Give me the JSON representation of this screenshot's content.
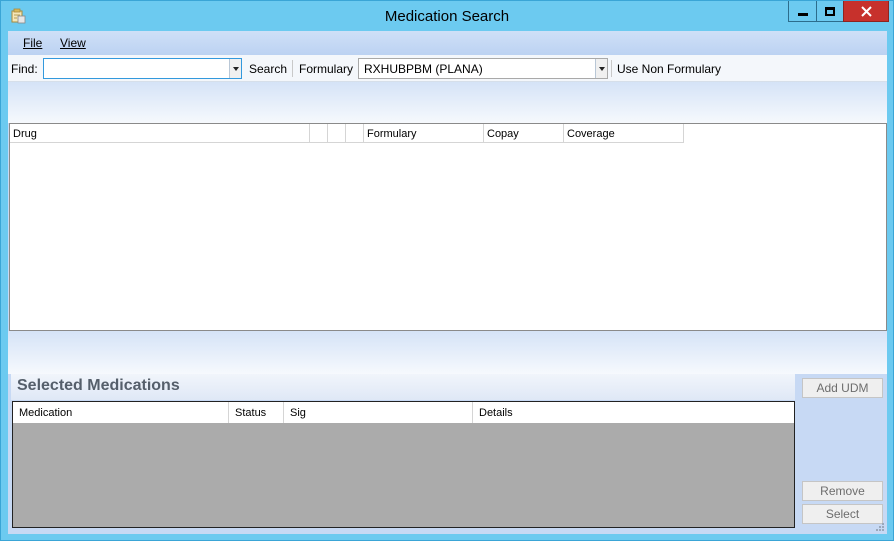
{
  "window": {
    "title": "Medication Search"
  },
  "menu": {
    "file": "File",
    "view": "View"
  },
  "search": {
    "find_label": "Find:",
    "find_value": "",
    "search_label": "Search",
    "formulary_label": "Formulary",
    "formulary_value": "RXHUBPBM (PLANA)",
    "non_formulary_label": "Use Non Formulary"
  },
  "drug_table": {
    "columns": [
      "Drug",
      "",
      "",
      "",
      "Formulary",
      "Copay",
      "Coverage"
    ]
  },
  "selected_medications": {
    "title": "Selected Medications",
    "columns": [
      "Medication",
      "Status",
      "Sig",
      "Details"
    ]
  },
  "buttons": {
    "add_udm": "Add UDM",
    "remove": "Remove",
    "select": "Select"
  },
  "colors": {
    "titlebar": "#6ccaf0",
    "close": "#c7312c",
    "client": "#c7d9f4"
  }
}
